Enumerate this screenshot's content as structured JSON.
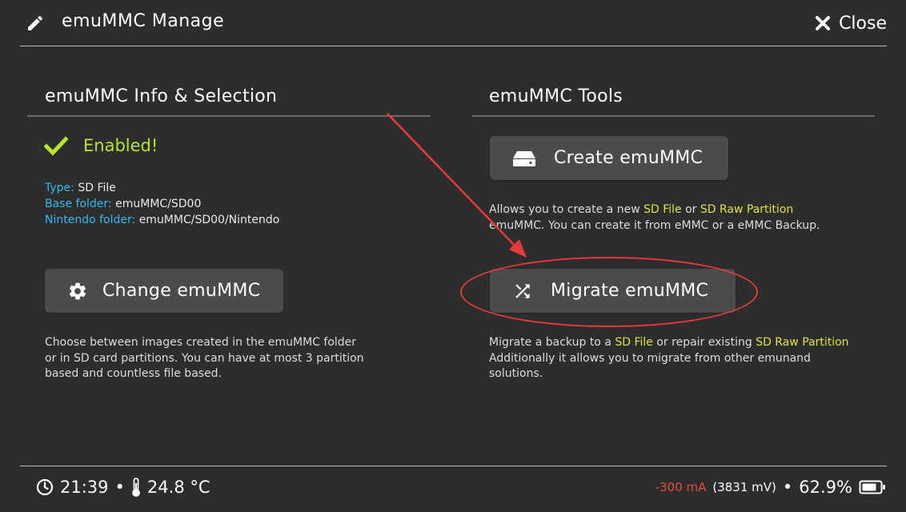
{
  "header": {
    "title": "emuMMC Manage",
    "close_label": "Close"
  },
  "left": {
    "section_title": "emuMMC Info & Selection",
    "status": "Enabled!",
    "info": [
      {
        "key": "Type:",
        "value": "SD File"
      },
      {
        "key": "Base folder:",
        "value": "emuMMC/SD00"
      },
      {
        "key": "Nintendo folder:",
        "value": "emuMMC/SD00/Nintendo"
      }
    ],
    "change_button": "Change emuMMC",
    "change_desc": [
      "Choose between images created in the emuMMC folder",
      "or in SD card partitions. You can have at most 3 partition",
      "based and countless file based."
    ]
  },
  "right": {
    "section_title": "emuMMC Tools",
    "create_button": "Create emuMMC",
    "create_desc": {
      "p1": "Allows you to create a new ",
      "hl1": "SD File",
      "p2": " or ",
      "hl2": "SD Raw Partition",
      "line2": "emuMMC. You can create it from eMMC or a eMMC Backup."
    },
    "migrate_button": "Migrate emuMMC",
    "migrate_desc": {
      "p1": "Migrate a backup to a ",
      "hl1": "SD File",
      "p2": " or repair existing ",
      "hl2": "SD Raw Partition",
      "line2": "Additionally it allows you to migrate from other emunand",
      "line3": "solutions."
    }
  },
  "footer": {
    "time": "21:39",
    "separator": "•",
    "temperature": "24.8 °C",
    "current": "-300 mA",
    "voltage": "(3831 mV)",
    "battery": "62.9%"
  },
  "colors": {
    "background": "#2d2d2d",
    "button": "#4b4b4b",
    "enabled_green": "#b4e62b",
    "info_key_blue": "#30b9ef",
    "highlight_yellow": "#dfe23a",
    "current_red": "#e84a3c",
    "annotation_red": "#e53a3a"
  },
  "icons": {
    "header": "pencil-icon",
    "close": "close-icon",
    "status": "checkmark-icon",
    "change": "gear-icon",
    "create": "drive-icon",
    "migrate": "shuffle-icon",
    "clock": "clock-icon",
    "temperature": "thermometer-icon",
    "battery": "battery-icon"
  }
}
